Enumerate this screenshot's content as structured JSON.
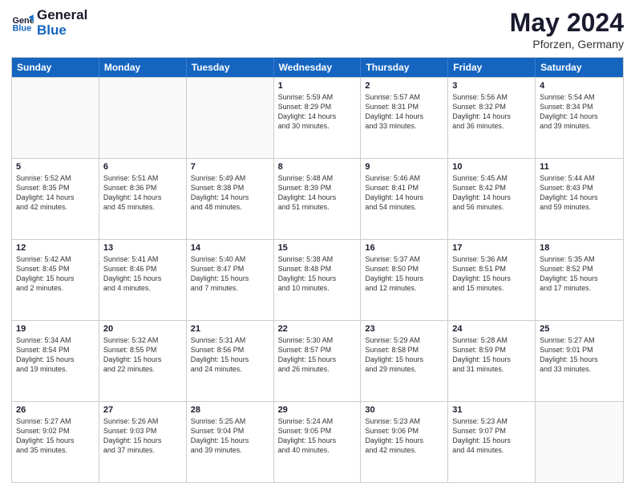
{
  "header": {
    "logo_line1": "General",
    "logo_line2": "Blue",
    "main_title": "May 2024",
    "subtitle": "Pforzen, Germany"
  },
  "weekdays": [
    "Sunday",
    "Monday",
    "Tuesday",
    "Wednesday",
    "Thursday",
    "Friday",
    "Saturday"
  ],
  "rows": [
    [
      {
        "day": "",
        "info": ""
      },
      {
        "day": "",
        "info": ""
      },
      {
        "day": "",
        "info": ""
      },
      {
        "day": "1",
        "info": "Sunrise: 5:59 AM\nSunset: 8:29 PM\nDaylight: 14 hours\nand 30 minutes."
      },
      {
        "day": "2",
        "info": "Sunrise: 5:57 AM\nSunset: 8:31 PM\nDaylight: 14 hours\nand 33 minutes."
      },
      {
        "day": "3",
        "info": "Sunrise: 5:56 AM\nSunset: 8:32 PM\nDaylight: 14 hours\nand 36 minutes."
      },
      {
        "day": "4",
        "info": "Sunrise: 5:54 AM\nSunset: 8:34 PM\nDaylight: 14 hours\nand 39 minutes."
      }
    ],
    [
      {
        "day": "5",
        "info": "Sunrise: 5:52 AM\nSunset: 8:35 PM\nDaylight: 14 hours\nand 42 minutes."
      },
      {
        "day": "6",
        "info": "Sunrise: 5:51 AM\nSunset: 8:36 PM\nDaylight: 14 hours\nand 45 minutes."
      },
      {
        "day": "7",
        "info": "Sunrise: 5:49 AM\nSunset: 8:38 PM\nDaylight: 14 hours\nand 48 minutes."
      },
      {
        "day": "8",
        "info": "Sunrise: 5:48 AM\nSunset: 8:39 PM\nDaylight: 14 hours\nand 51 minutes."
      },
      {
        "day": "9",
        "info": "Sunrise: 5:46 AM\nSunset: 8:41 PM\nDaylight: 14 hours\nand 54 minutes."
      },
      {
        "day": "10",
        "info": "Sunrise: 5:45 AM\nSunset: 8:42 PM\nDaylight: 14 hours\nand 56 minutes."
      },
      {
        "day": "11",
        "info": "Sunrise: 5:44 AM\nSunset: 8:43 PM\nDaylight: 14 hours\nand 59 minutes."
      }
    ],
    [
      {
        "day": "12",
        "info": "Sunrise: 5:42 AM\nSunset: 8:45 PM\nDaylight: 15 hours\nand 2 minutes."
      },
      {
        "day": "13",
        "info": "Sunrise: 5:41 AM\nSunset: 8:46 PM\nDaylight: 15 hours\nand 4 minutes."
      },
      {
        "day": "14",
        "info": "Sunrise: 5:40 AM\nSunset: 8:47 PM\nDaylight: 15 hours\nand 7 minutes."
      },
      {
        "day": "15",
        "info": "Sunrise: 5:38 AM\nSunset: 8:48 PM\nDaylight: 15 hours\nand 10 minutes."
      },
      {
        "day": "16",
        "info": "Sunrise: 5:37 AM\nSunset: 8:50 PM\nDaylight: 15 hours\nand 12 minutes."
      },
      {
        "day": "17",
        "info": "Sunrise: 5:36 AM\nSunset: 8:51 PM\nDaylight: 15 hours\nand 15 minutes."
      },
      {
        "day": "18",
        "info": "Sunrise: 5:35 AM\nSunset: 8:52 PM\nDaylight: 15 hours\nand 17 minutes."
      }
    ],
    [
      {
        "day": "19",
        "info": "Sunrise: 5:34 AM\nSunset: 8:54 PM\nDaylight: 15 hours\nand 19 minutes."
      },
      {
        "day": "20",
        "info": "Sunrise: 5:32 AM\nSunset: 8:55 PM\nDaylight: 15 hours\nand 22 minutes."
      },
      {
        "day": "21",
        "info": "Sunrise: 5:31 AM\nSunset: 8:56 PM\nDaylight: 15 hours\nand 24 minutes."
      },
      {
        "day": "22",
        "info": "Sunrise: 5:30 AM\nSunset: 8:57 PM\nDaylight: 15 hours\nand 26 minutes."
      },
      {
        "day": "23",
        "info": "Sunrise: 5:29 AM\nSunset: 8:58 PM\nDaylight: 15 hours\nand 29 minutes."
      },
      {
        "day": "24",
        "info": "Sunrise: 5:28 AM\nSunset: 8:59 PM\nDaylight: 15 hours\nand 31 minutes."
      },
      {
        "day": "25",
        "info": "Sunrise: 5:27 AM\nSunset: 9:01 PM\nDaylight: 15 hours\nand 33 minutes."
      }
    ],
    [
      {
        "day": "26",
        "info": "Sunrise: 5:27 AM\nSunset: 9:02 PM\nDaylight: 15 hours\nand 35 minutes."
      },
      {
        "day": "27",
        "info": "Sunrise: 5:26 AM\nSunset: 9:03 PM\nDaylight: 15 hours\nand 37 minutes."
      },
      {
        "day": "28",
        "info": "Sunrise: 5:25 AM\nSunset: 9:04 PM\nDaylight: 15 hours\nand 39 minutes."
      },
      {
        "day": "29",
        "info": "Sunrise: 5:24 AM\nSunset: 9:05 PM\nDaylight: 15 hours\nand 40 minutes."
      },
      {
        "day": "30",
        "info": "Sunrise: 5:23 AM\nSunset: 9:06 PM\nDaylight: 15 hours\nand 42 minutes."
      },
      {
        "day": "31",
        "info": "Sunrise: 5:23 AM\nSunset: 9:07 PM\nDaylight: 15 hours\nand 44 minutes."
      },
      {
        "day": "",
        "info": ""
      }
    ]
  ]
}
